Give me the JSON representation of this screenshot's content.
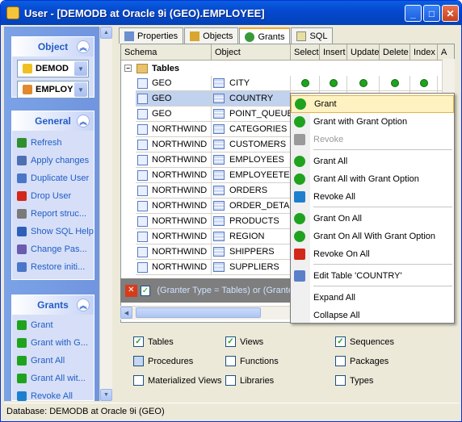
{
  "window": {
    "title": "User - [DEMODB  at Oracle 9i (GEO).EMPLOYEE]"
  },
  "colors": {
    "accent": "#215dc6",
    "grant_dot": "#1fa31f",
    "selection": "#c1d2ee"
  },
  "left": {
    "object": {
      "title": "Object",
      "db": "DEMOD",
      "user": "EMPLOY"
    },
    "general": {
      "title": "General",
      "items": [
        {
          "label": "Refresh",
          "icon": "refresh-icon"
        },
        {
          "label": "Apply changes",
          "icon": "wrench-icon"
        },
        {
          "label": "Duplicate User",
          "icon": "duplicate-icon"
        },
        {
          "label": "Drop User",
          "icon": "drop-icon"
        },
        {
          "label": "Report struc...",
          "icon": "print-icon"
        },
        {
          "label": "Show SQL Help",
          "icon": "help-icon"
        },
        {
          "label": "Change Pas...",
          "icon": "password-icon"
        },
        {
          "label": "Restore initi...",
          "icon": "restore-icon"
        }
      ]
    },
    "grants": {
      "title": "Grants",
      "items": [
        {
          "label": "Grant",
          "icon": "grant-icon"
        },
        {
          "label": "Grant with G...",
          "icon": "grant-with-option-icon"
        },
        {
          "label": "Grant All",
          "icon": "grant-all-icon"
        },
        {
          "label": "Grant All wit...",
          "icon": "grant-all-option-icon"
        },
        {
          "label": "Revoke All",
          "icon": "revoke-all-icon"
        }
      ]
    }
  },
  "tabs": [
    {
      "label": "Properties"
    },
    {
      "label": "Objects"
    },
    {
      "label": "Grants"
    },
    {
      "label": "SQL"
    }
  ],
  "grid": {
    "headers": [
      "Schema",
      "Object",
      "Select",
      "Insert",
      "Update",
      "Delete",
      "Index",
      "A"
    ],
    "group_label": "Tables",
    "rows": [
      {
        "schema": "GEO",
        "object": "CITY",
        "grants": [
          true,
          true,
          true,
          true,
          true
        ]
      },
      {
        "schema": "GEO",
        "object": "COUNTRY",
        "grants": [
          false,
          false,
          false,
          false,
          false
        ]
      },
      {
        "schema": "GEO",
        "object": "POINT_QUEUE",
        "grants": [
          false,
          false,
          false,
          false,
          false
        ]
      },
      {
        "schema": "NORTHWIND",
        "object": "CATEGORIES",
        "grants": [
          false,
          false,
          false,
          false,
          false
        ]
      },
      {
        "schema": "NORTHWIND",
        "object": "CUSTOMERS",
        "grants": [
          false,
          false,
          false,
          false,
          false
        ]
      },
      {
        "schema": "NORTHWIND",
        "object": "EMPLOYEES",
        "grants": [
          false,
          false,
          false,
          false,
          false
        ]
      },
      {
        "schema": "NORTHWIND",
        "object": "EMPLOYEETER",
        "grants": [
          false,
          false,
          false,
          false,
          false
        ]
      },
      {
        "schema": "NORTHWIND",
        "object": "ORDERS",
        "grants": [
          false,
          false,
          false,
          false,
          false
        ]
      },
      {
        "schema": "NORTHWIND",
        "object": "ORDER_DETA",
        "grants": [
          false,
          false,
          false,
          false,
          false
        ]
      },
      {
        "schema": "NORTHWIND",
        "object": "PRODUCTS",
        "grants": [
          false,
          false,
          false,
          false,
          false
        ]
      },
      {
        "schema": "NORTHWIND",
        "object": "REGION",
        "grants": [
          false,
          false,
          false,
          false,
          false
        ]
      },
      {
        "schema": "NORTHWIND",
        "object": "SHIPPERS",
        "grants": [
          false,
          false,
          false,
          false,
          false
        ]
      },
      {
        "schema": "NORTHWIND",
        "object": "SUPPLIERS",
        "grants": [
          false,
          false,
          false,
          false,
          false
        ]
      }
    ],
    "filter_text": "(Granter Type = Tables) or (Grante"
  },
  "context_menu": {
    "items": [
      {
        "label": "Grant",
        "icon": "grant-icon",
        "state": "selected"
      },
      {
        "label": "Grant with Grant Option",
        "icon": "grant-with-option-icon",
        "state": "normal"
      },
      {
        "label": "Revoke",
        "icon": "revoke-icon",
        "state": "disabled"
      },
      {
        "label": "Grant All",
        "icon": "grant-all-icon",
        "state": "normal"
      },
      {
        "label": "Grant All with Grant Option",
        "icon": "grant-all-option-icon",
        "state": "normal"
      },
      {
        "label": "Revoke All",
        "icon": "revoke-all-icon",
        "state": "normal"
      },
      {
        "label": "Grant On All",
        "icon": "grant-on-all-icon",
        "state": "normal"
      },
      {
        "label": "Grant On All With Grant Option",
        "icon": "grant-on-all-option-icon",
        "state": "normal"
      },
      {
        "label": "Revoke On All",
        "icon": "revoke-on-all-icon",
        "state": "normal"
      },
      {
        "label": "Edit Table 'COUNTRY'",
        "icon": "edit-table-icon",
        "state": "normal"
      },
      {
        "label": "Expand All",
        "icon": "",
        "state": "normal"
      },
      {
        "label": "Collapse All",
        "icon": "",
        "state": "normal"
      }
    ]
  },
  "options": [
    {
      "label": "Tables",
      "checked": true
    },
    {
      "label": "Views",
      "checked": true
    },
    {
      "label": "Sequences",
      "checked": true
    },
    {
      "label": "Procedures",
      "checked": false
    },
    {
      "label": "Functions",
      "checked": false
    },
    {
      "label": "Packages",
      "checked": false
    },
    {
      "label": "Materialized Views",
      "checked": false
    },
    {
      "label": "Libraries",
      "checked": false
    },
    {
      "label": "Types",
      "checked": false
    }
  ],
  "status": {
    "text": "Database: DEMODB  at Oracle 9i (GEO)"
  }
}
